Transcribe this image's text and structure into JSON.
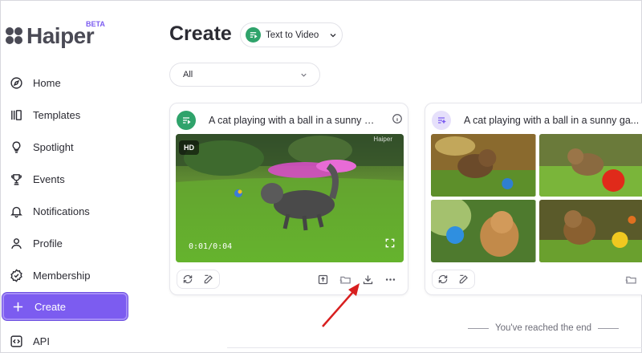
{
  "app": {
    "logo_text": "Haiper",
    "beta_label": "BETA"
  },
  "sidebar": {
    "items": [
      {
        "label": "Home",
        "icon": "compass-icon"
      },
      {
        "label": "Templates",
        "icon": "templates-icon"
      },
      {
        "label": "Spotlight",
        "icon": "lightbulb-icon"
      },
      {
        "label": "Events",
        "icon": "trophy-icon"
      },
      {
        "label": "Notifications",
        "icon": "bell-icon"
      },
      {
        "label": "Profile",
        "icon": "user-icon"
      },
      {
        "label": "Membership",
        "icon": "badge-check-icon"
      },
      {
        "label": "Create",
        "icon": "plus-icon",
        "active": true
      },
      {
        "label": "API",
        "icon": "code-icon"
      }
    ]
  },
  "header": {
    "title": "Create",
    "mode_label": "Text to Video"
  },
  "filter": {
    "selected": "All"
  },
  "cards": [
    {
      "prompt": "A cat playing with a ball in a sunny ga...",
      "type": "video",
      "hd_badge": "HD",
      "watermark": "Haiper",
      "timecode": "0:01/0:04",
      "accent": "#2fa36b"
    },
    {
      "prompt": "A cat playing with a ball in a sunny ga...",
      "type": "images",
      "accent": "#e6e0fb"
    }
  ],
  "feed": {
    "end_text": "You've reached the end"
  },
  "colors": {
    "brand": "#7c5cf0",
    "annotation_arrow": "#d81f1f"
  }
}
